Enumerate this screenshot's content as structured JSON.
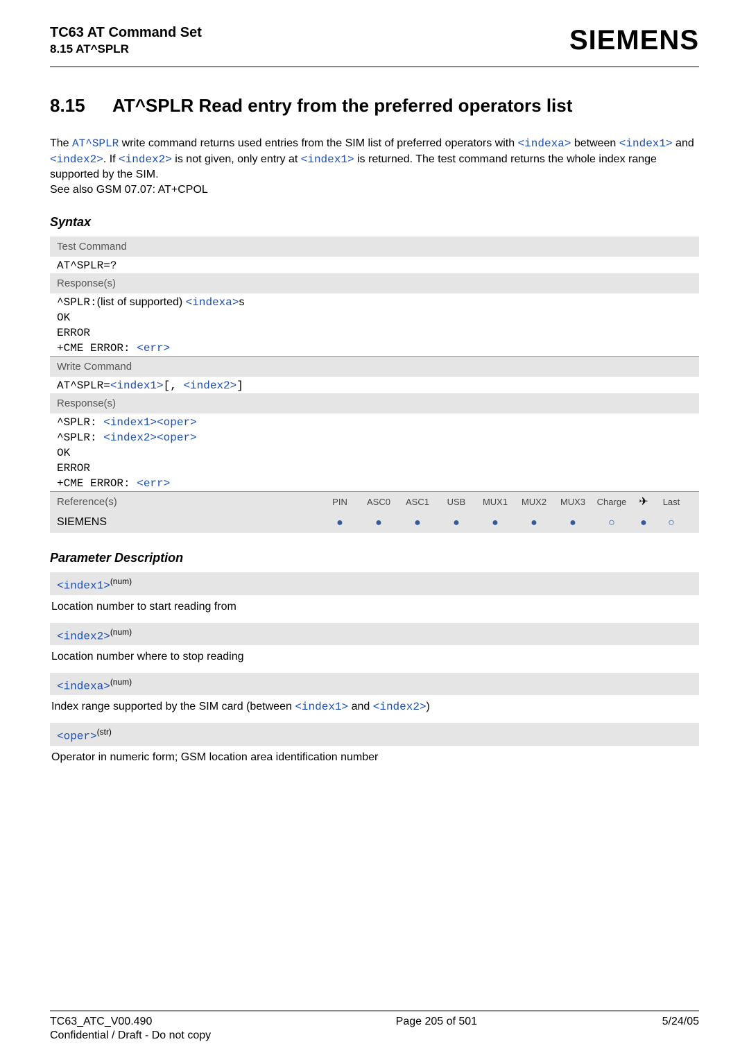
{
  "header": {
    "product": "TC63 AT Command Set",
    "section_ref": "8.15 AT^SPLR",
    "brand": "SIEMENS"
  },
  "title": {
    "number": "8.15",
    "text": "AT^SPLR   Read entry from the preferred operators list"
  },
  "intro": {
    "part1": "The ",
    "cmd": "AT^SPLR",
    "part2": " write command returns used entries from the SIM list of preferred operators with ",
    "idxa": "<indexa>",
    "part3": " between ",
    "idx1": "<index1>",
    "and": " and ",
    "idx2": "<index2>",
    "part4": ". If ",
    "idx2b": "<index2>",
    "part5": " is not given, only entry at ",
    "idx1b": "<index1>",
    "part6": " is returned. The test command returns the whole index range supported by the SIM.",
    "seealso": "See also GSM 07.07: AT+CPOL"
  },
  "syntax_label": "Syntax",
  "test_block": {
    "label": "Test Command",
    "cmd": "AT^SPLR=?",
    "resp_label": "Response(s)",
    "resp1_prefix": "^SPLR:",
    "resp1_mid": "(list of supported) ",
    "resp1_idx": "<indexa>",
    "resp1_suffix": "s",
    "ok": "OK",
    "error": "ERROR",
    "cme_prefix": "+CME ERROR: ",
    "cme_err": "<err>"
  },
  "write_block": {
    "label": "Write Command",
    "cmd_prefix": "AT^SPLR=",
    "idx1": "<index1>",
    "mid": "[, ",
    "idx2": "<index2>",
    "suffix": "]",
    "resp_label": "Response(s)",
    "line1_prefix": "^SPLR: ",
    "line1_a": "<index1>",
    "line1_b": "<oper>",
    "line2_prefix": "^SPLR: ",
    "line2_a": "<index2>",
    "line2_b": "<oper>",
    "ok": "OK",
    "error": "ERROR",
    "cme_prefix": "+CME ERROR: ",
    "cme_err": "<err>"
  },
  "reference": {
    "ref_label": "Reference(s)",
    "siemens": "SIEMENS",
    "cols": [
      "PIN",
      "ASC0",
      "ASC1",
      "USB",
      "MUX1",
      "MUX2",
      "MUX3",
      "Charge",
      "",
      "Last"
    ]
  },
  "param_label": "Parameter Description",
  "params": {
    "p1_name": "<index1>",
    "p1_sup": "(num)",
    "p1_desc": "Location number to start reading from",
    "p2_name": "<index2>",
    "p2_sup": "(num)",
    "p2_desc": "Location number where to stop reading",
    "p3_name": "<indexa>",
    "p3_sup": "(num)",
    "p3_desc_a": "Index range supported by the SIM card (between ",
    "p3_i1": "<index1>",
    "p3_and": " and ",
    "p3_i2": "<index2>",
    "p3_close": ")",
    "p4_name": "<oper>",
    "p4_sup": "(str)",
    "p4_desc": "Operator in numeric form; GSM location area identification number"
  },
  "footer": {
    "left": "TC63_ATC_V00.490",
    "center": "Page 205 of 501",
    "right": "5/24/05",
    "conf": "Confidential / Draft - Do not copy"
  }
}
